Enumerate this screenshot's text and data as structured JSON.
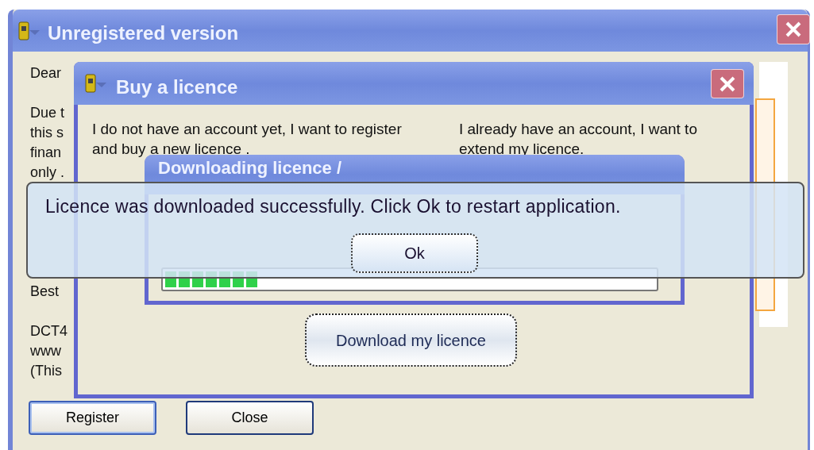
{
  "main_window": {
    "title": "Unregistered version",
    "paragraphs": [
      [
        "Dear"
      ],
      [
        "Due t",
        "this s",
        "finan",
        "only ."
      ],
      [
        "Best"
      ],
      [
        "DCT4",
        "www",
        "(This"
      ]
    ],
    "buttons": [
      {
        "label": "Register",
        "default": true
      },
      {
        "label": "Close",
        "default": false
      }
    ]
  },
  "buy_window": {
    "title": "Buy a licence",
    "left_text": "I do not have an account yet, I want to register and buy a new licence .",
    "right_text": "I already have an account, I want to extend my licence.",
    "button": "Download my licence"
  },
  "download_window": {
    "title": "Downloading licence /",
    "progress": {
      "level": 0.19
    }
  },
  "message_box": {
    "text": "Licence was downloaded successfully. Click Ok to restart application.",
    "button": "Ok"
  }
}
